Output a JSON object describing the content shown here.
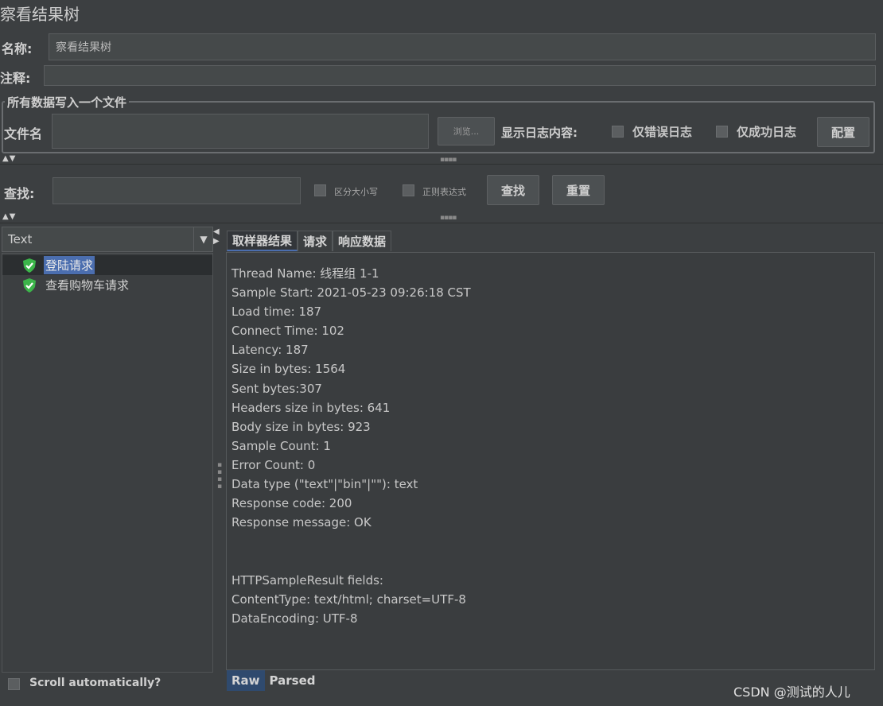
{
  "window": {
    "title": "察看结果树"
  },
  "form": {
    "name_label": "名称:",
    "name_value": "察看结果树",
    "comment_label": "注释:",
    "comment_value": ""
  },
  "file_section": {
    "legend": "所有数据写入一个文件",
    "filename_label": "文件名",
    "filename_value": "",
    "browse_button": "浏览...",
    "log_content_label": "显示日志内容:",
    "errors_only_label": "仅错误日志",
    "success_only_label": "仅成功日志",
    "config_button": "配置"
  },
  "search": {
    "label": "查找:",
    "value": "",
    "case_sensitive_label": "区分大小写",
    "regex_label": "正则表达式",
    "search_button": "查找",
    "reset_button": "重置"
  },
  "left_panel": {
    "renderer_value": "Text",
    "tree_items": [
      {
        "label": "登陆请求",
        "selected": true,
        "icon": "shield-check-icon"
      },
      {
        "label": "查看购物车请求",
        "selected": false,
        "icon": "shield-check-icon"
      }
    ],
    "scroll_label": "Scroll automatically?"
  },
  "right_panel": {
    "tabs": [
      "取样器结果",
      "请求",
      "响应数据"
    ],
    "active_tab": 0,
    "lines": [
      "Thread Name: 线程组 1-1",
      "Sample Start: 2021-05-23 09:26:18 CST",
      "Load time: 187",
      "Connect Time: 102",
      "Latency: 187",
      "Size in bytes: 1564",
      "Sent bytes:307",
      "Headers size in bytes: 641",
      "Body size in bytes: 923",
      "Sample Count: 1",
      "Error Count: 0",
      "Data type (\"text\"|\"bin\"|\"\"): text",
      "Response code: 200",
      "Response message: OK",
      "",
      "",
      "HTTPSampleResult fields:",
      "ContentType: text/html; charset=UTF-8",
      "DataEncoding: UTF-8"
    ],
    "bottom_tabs": [
      "Raw",
      "Parsed"
    ],
    "bottom_active": 0
  },
  "watermark": "CSDN @测试的人儿",
  "colors": {
    "background": "#3c3f41",
    "selection": "#4b6eaf",
    "success_icon": "#3cb54a"
  }
}
